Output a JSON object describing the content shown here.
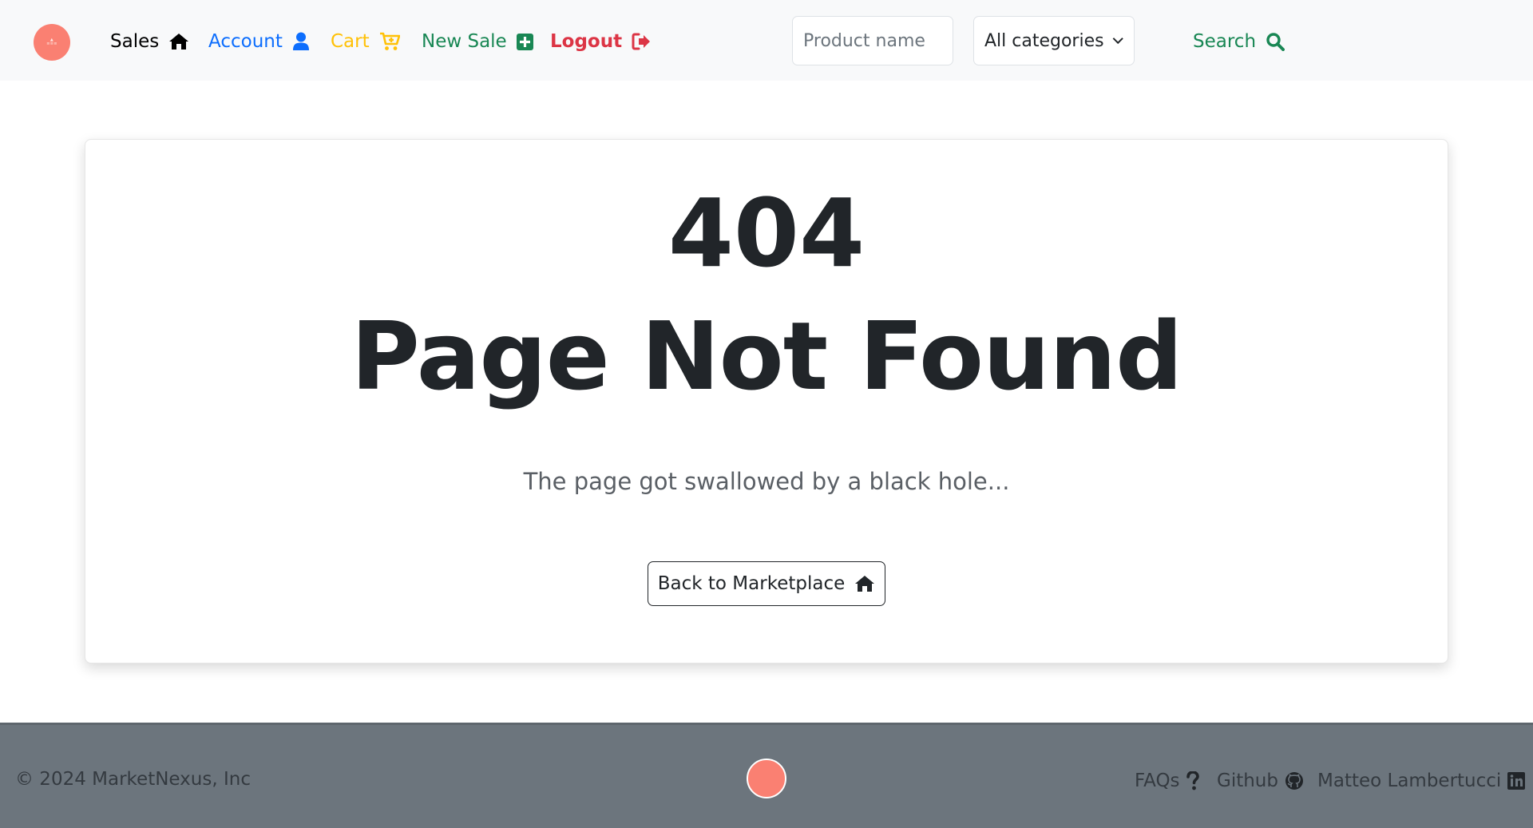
{
  "nav": {
    "sales_label": "Sales",
    "account_label": "Account",
    "cart_label": "Cart",
    "new_sale_label": "New Sale",
    "logout_label": "Logout"
  },
  "search": {
    "placeholder": "Product name",
    "category_selected": "All categories",
    "button_label": "Search"
  },
  "error": {
    "code": "404",
    "title": "Page Not Found",
    "message": "The page got swallowed by a black hole...",
    "back_button_label": "Back to Marketplace"
  },
  "footer": {
    "copyright": "© 2024 MarketNexus, Inc",
    "faqs_label": "FAQs",
    "github_label": "Github",
    "linkedin_label": "Matteo Lambertucci"
  },
  "colors": {
    "navbar_bg": "#f8f9fa",
    "account": "#0d6efd",
    "cart": "#ffc107",
    "new_sale": "#198754",
    "logout": "#dc3545",
    "search": "#198754",
    "logo": "#fa8072",
    "footer_bg": "#6c757d"
  },
  "icons": {
    "sales": "house-icon",
    "account": "user-icon",
    "cart": "cart-plus-icon",
    "new_sale": "plus-square-icon",
    "logout": "sign-out-icon",
    "search": "magnifier-icon",
    "category": "chevron-down-icon",
    "back": "house-icon",
    "faqs": "question-icon",
    "github": "github-icon",
    "linkedin": "linkedin-icon"
  }
}
